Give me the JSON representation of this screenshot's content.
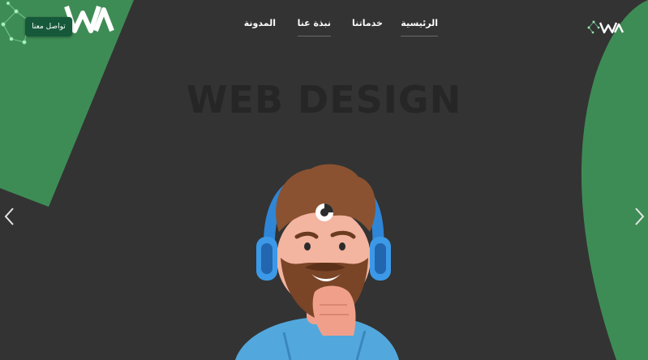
{
  "page": {
    "colors": {
      "background": "#333333",
      "accent_green": "#3e8c55",
      "button_green": "#15593a",
      "title_text": "#262626"
    }
  },
  "header": {
    "logo_icon": "wva-logo-icon",
    "contact_button_label": "تواصل معنا",
    "nav": [
      {
        "label": "الرئيسية",
        "active": true
      },
      {
        "label": "خدماتنا",
        "active": false
      },
      {
        "label": "نبذة عنا",
        "active": true
      },
      {
        "label": "المدونة",
        "active": false
      }
    ]
  },
  "hero": {
    "title": "WEB DESIGN",
    "illustration": "bearded-man-with-headphones-illustration"
  },
  "carousel": {
    "prev_icon": "chevron-left-icon",
    "next_icon": "chevron-right-icon"
  }
}
